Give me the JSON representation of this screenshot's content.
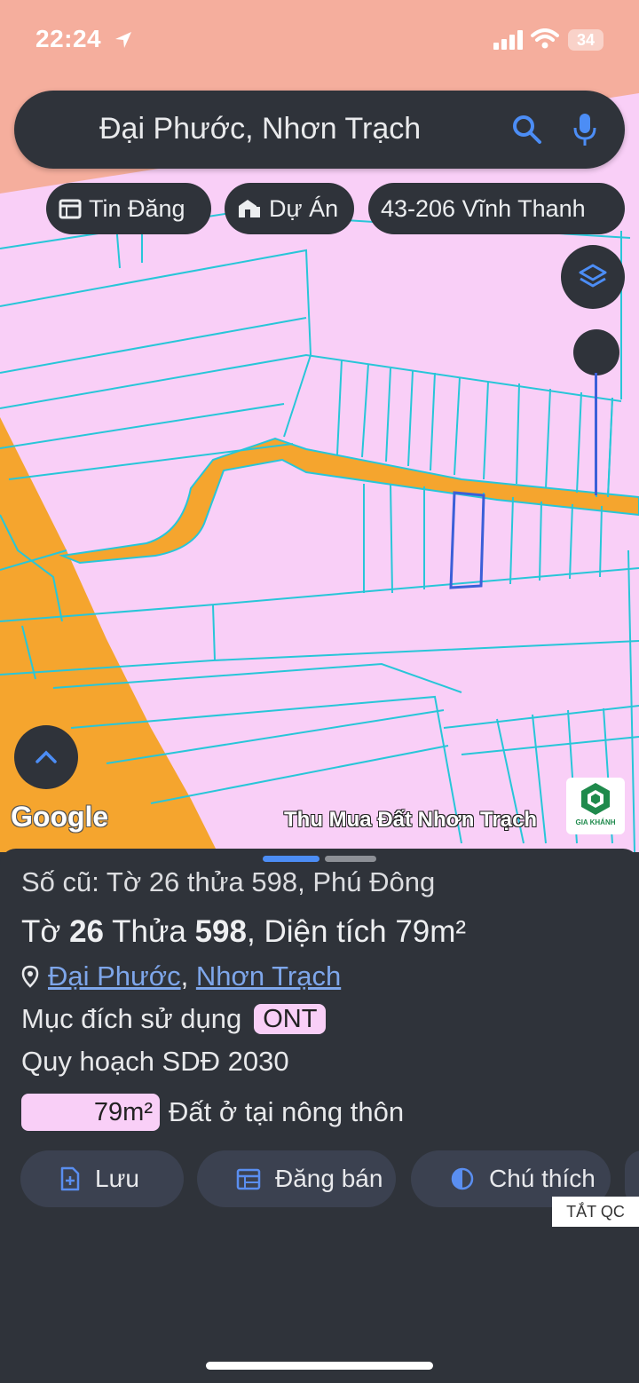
{
  "status_bar": {
    "time": "22:24",
    "battery": "34"
  },
  "search": {
    "query": "Đại Phước, Nhơn Trạch"
  },
  "chips": [
    {
      "label": "Tin Đăng",
      "icon": "calendar-icon"
    },
    {
      "label": "Dự Án",
      "icon": "building-icon"
    },
    {
      "label": "43-206 Vĩnh Thanh"
    }
  ],
  "map": {
    "google_logo": "Google",
    "watermark": "Thu Mua Đất Nhơn Trạch",
    "brand_logo_text": "GIA KHÁNH",
    "colors": {
      "land": "#f9cff7",
      "road": "#f5a52e",
      "water": "#f5ae9d",
      "parcel_line": "#28c6d8",
      "selected_line": "#3b5fd8"
    }
  },
  "sheet": {
    "old_parcel": "Số cũ: Tờ 26 thửa 598, Phú Đông",
    "sheet_label": "Tờ",
    "sheet_number": "26",
    "parcel_label": "Thửa",
    "parcel_number": "598",
    "area_text": "Diện tích 79m²",
    "commune": "Đại Phước",
    "district": "Nhơn Trạch",
    "purpose_label": "Mục đích sử dụng",
    "purpose_code": "ONT",
    "plan_label": "Quy hoạch SDĐ 2030",
    "legend_area": "79m²",
    "legend_text": "Đất ở tại nông thôn",
    "actions": {
      "save": "Lưu",
      "sell": "Đăng bán",
      "legend": "Chú thích"
    },
    "ad_button": "TẮT QC"
  }
}
